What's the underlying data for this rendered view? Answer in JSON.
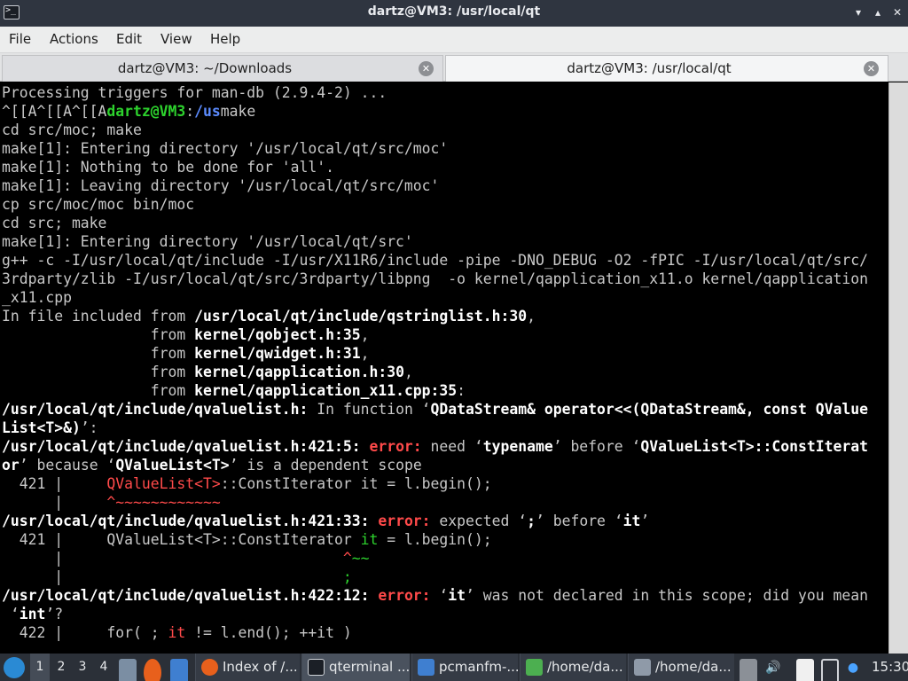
{
  "window": {
    "title": "dartz@VM3: /usr/local/qt",
    "minimize": "▾",
    "maximize": "▴",
    "close": "✕"
  },
  "menu": [
    "File",
    "Actions",
    "Edit",
    "View",
    "Help"
  ],
  "tabs": [
    {
      "label": "dartz@VM3: ~/Downloads",
      "close": "✕"
    },
    {
      "label": "dartz@VM3: /usr/local/qt",
      "close": "✕"
    }
  ],
  "terminal": {
    "colors": {
      "prompt_user": "#2dd22d",
      "prompt_path": "#5c8cff",
      "error": "#ff4a4a"
    },
    "lines": [
      {
        "t": "Processing triggers for man-db (2.9.4-2) ..."
      },
      {
        "a": "^[[A^[[A^[[A",
        "u": "dartz@VM3",
        "c": ":",
        "p": "/us",
        "d": "make"
      },
      {
        "t": "cd src/moc; make"
      },
      {
        "t": "make[1]: Entering directory '/usr/local/qt/src/moc'"
      },
      {
        "t": "make[1]: Nothing to be done for 'all'."
      },
      {
        "t": "make[1]: Leaving directory '/usr/local/qt/src/moc'"
      },
      {
        "t": "cp src/moc/moc bin/moc"
      },
      {
        "t": "cd src; make"
      },
      {
        "t": "make[1]: Entering directory '/usr/local/qt/src'"
      },
      {
        "t": "g++ -c -I/usr/local/qt/include -I/usr/X11R6/include -pipe -DNO_DEBUG -O2 -fPIC -I/usr/local/qt/src/"
      },
      {
        "t": "3rdparty/zlib -I/usr/local/qt/src/3rdparty/libpng  -o kernel/qapplication_x11.o kernel/qapplication"
      },
      {
        "t": "_x11.cpp"
      },
      {
        "a": "In file included from ",
        "b": "/usr/local/qt/include/qstringlist.h:30",
        "c": ","
      },
      {
        "a": "                 from ",
        "b": "kernel/qobject.h:35",
        "c": ","
      },
      {
        "a": "                 from ",
        "b": "kernel/qwidget.h:31",
        "c": ","
      },
      {
        "a": "                 from ",
        "b": "kernel/qapplication.h:30",
        "c": ","
      },
      {
        "a": "                 from ",
        "b": "kernel/qapplication_x11.cpp:35",
        "c": ":"
      },
      {
        "b": "/usr/local/qt/include/qvaluelist.h:",
        "a": " In function ‘",
        "b2": "QDataStream& operator<<(QDataStream&, const QValue"
      },
      {
        "b": "List<T>&)",
        "a": "’:"
      },
      {
        "b": "/usr/local/qt/include/qvaluelist.h:421:5:",
        "e": " error:",
        "a": " need ‘",
        "b2": "typename",
        "a2": "’ before ‘",
        "b3": "QValueList<T>::ConstIterat"
      },
      {
        "b": "or",
        "a": "’ because ‘",
        "b2": "QValueList<T>",
        "a2": "’ is a dependent scope"
      },
      {
        "n": "  421 |     ",
        "r": "QValueList<T>",
        "a": "::ConstIterator it = l.begin();"
      },
      {
        "n": "      |     ",
        "r": "^~~~~~~~~~~~~"
      },
      {
        "b": "/usr/local/qt/include/qvaluelist.h:421:33:",
        "e": " error:",
        "a": " expected ‘",
        "b2": ";",
        "a2": "’ before ‘",
        "b3": "it",
        "a3": "’"
      },
      {
        "n": "  421 |     ",
        "a": "QValueList<T>::ConstIterator ",
        "gtx": "it",
        "a2": " = l.begin();"
      },
      {
        "n": "      |                                ",
        "r": "^",
        "gtx": "~~"
      },
      {
        "n": "      |                                ",
        "gtx": ";"
      },
      {
        "b": "/usr/local/qt/include/qvaluelist.h:422:12:",
        "e": " error:",
        "a": " ‘",
        "b2": "it",
        "a2": "’ was not declared in this scope; did you mean"
      },
      {
        "a": " ‘",
        "b": "int",
        "a2": "’?"
      },
      {
        "n": "  422 |     ",
        "a": "for( ; ",
        "r": "it",
        "a2": " != l.end(); ++it )"
      }
    ]
  },
  "taskbar": {
    "workspaces": [
      "1",
      "2",
      "3",
      "4"
    ],
    "tasks": [
      {
        "label": "Index of /...",
        "icon": "firefox-icon",
        "color": "#e8601c"
      },
      {
        "label": "qterminal ...",
        "icon": "terminal-icon",
        "color": "#1b1f26"
      },
      {
        "label": "pcmanfm-...",
        "icon": "folder-icon",
        "color": "#3f7fd0"
      },
      {
        "label": "/home/da...",
        "icon": "text-file-icon",
        "color": "#4caf50"
      },
      {
        "label": "/home/da...",
        "icon": "text-editor-icon",
        "color": "#8f9aa8"
      }
    ],
    "clock": "15:30"
  }
}
